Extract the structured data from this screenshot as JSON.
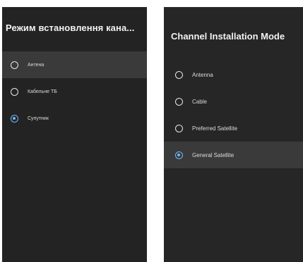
{
  "left_panel": {
    "title": "Режим встановлення кана...",
    "options": [
      {
        "label": "Антена",
        "selected": false,
        "highlighted": true
      },
      {
        "label": "Кабельне ТБ",
        "selected": false,
        "highlighted": false
      },
      {
        "label": "Супутник",
        "selected": true,
        "highlighted": false
      }
    ]
  },
  "right_panel": {
    "title": "Channel Installation Mode",
    "options": [
      {
        "label": "Antenna",
        "selected": false,
        "highlighted": false
      },
      {
        "label": "Cable",
        "selected": false,
        "highlighted": false
      },
      {
        "label": "Preferred Satellite",
        "selected": false,
        "highlighted": false
      },
      {
        "label": "General Satellite",
        "selected": true,
        "highlighted": true
      }
    ]
  },
  "colors": {
    "panel_background": "#232323",
    "highlight_row": "#3a3a3a",
    "radio_selected": "#6fb6ff",
    "text": "#dcdcdc"
  }
}
